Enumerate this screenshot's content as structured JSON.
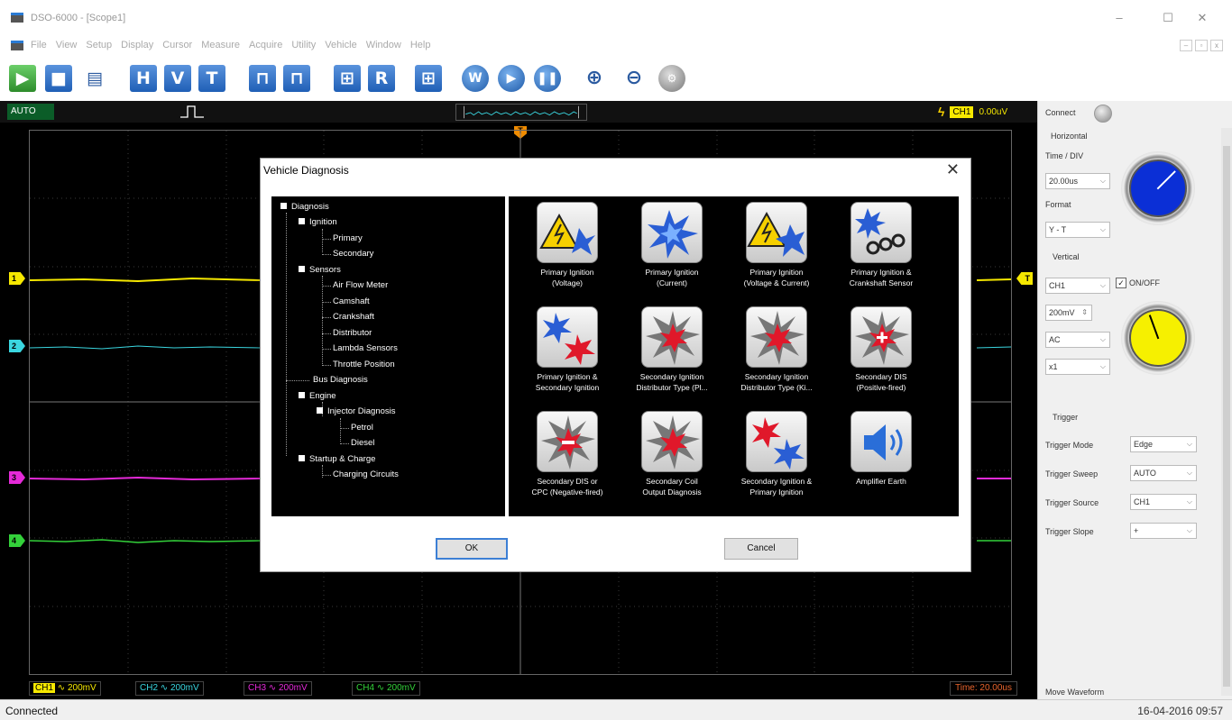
{
  "window": {
    "title": "DSO-6000 - [Scope1]",
    "controls": {
      "minimize": "–",
      "maximize": "☐",
      "close": "✕"
    }
  },
  "menu": {
    "items": [
      "File",
      "View",
      "Setup",
      "Display",
      "Cursor",
      "Measure",
      "Acquire",
      "Utility",
      "Vehicle",
      "Window",
      "Help"
    ],
    "mdi": {
      "min": "–",
      "restore": "▫",
      "close": "x"
    }
  },
  "toolbar": {
    "buttons": [
      {
        "name": "open",
        "glyph": "▶"
      },
      {
        "name": "save",
        "glyph": "■"
      },
      {
        "name": "print",
        "glyph": "▤"
      },
      {
        "name": "horizontal",
        "glyph": "H"
      },
      {
        "name": "vertical",
        "glyph": "V"
      },
      {
        "name": "trigger",
        "glyph": "T"
      },
      {
        "name": "measure-1",
        "glyph": "⊓"
      },
      {
        "name": "measure-2",
        "glyph": "⊓"
      },
      {
        "name": "ref-1",
        "glyph": "⊞"
      },
      {
        "name": "reference",
        "glyph": "R"
      },
      {
        "name": "ref-2",
        "glyph": "⊞"
      },
      {
        "name": "auto",
        "glyph": "W"
      },
      {
        "name": "run",
        "glyph": "▶"
      },
      {
        "name": "stop",
        "glyph": "❚❚"
      },
      {
        "name": "zoom-in",
        "glyph": "⊕"
      },
      {
        "name": "zoom-out",
        "glyph": "⊖"
      },
      {
        "name": "settings",
        "glyph": "⚙"
      }
    ]
  },
  "scope": {
    "mode": "AUTO",
    "trigger_channel": "CH1",
    "trigger_level": "0.00uV",
    "trigger_marker": "T",
    "channel_markers": [
      "1",
      "2",
      "3",
      "4"
    ],
    "footer": {
      "ch1": {
        "name": "CH1",
        "coupling": "∿",
        "scale": "200mV",
        "color": "#f6e800"
      },
      "ch2": {
        "name": "CH2",
        "coupling": "∿",
        "scale": "200mV",
        "color": "#3ad6e0"
      },
      "ch3": {
        "name": "CH3",
        "coupling": "∿",
        "scale": "200mV",
        "color": "#e52ad9"
      },
      "ch4": {
        "name": "CH4",
        "coupling": "∿",
        "scale": "200mV",
        "color": "#33d13a"
      },
      "time": "Time: 20.00us"
    }
  },
  "panel": {
    "connect": "Connect",
    "horizontal": {
      "title": "Horizontal",
      "time_div_label": "Time / DIV",
      "time_div": "20.00us",
      "format_label": "Format",
      "format": "Y - T"
    },
    "vertical": {
      "title": "Vertical",
      "channel": "CH1",
      "onoff_label": "ON/OFF",
      "onoff_checked": "✓",
      "volts": "200mV",
      "coupling": "AC",
      "probe": "x1"
    },
    "trigger": {
      "title": "Trigger",
      "mode_label": "Trigger Mode",
      "mode": "Edge",
      "sweep_label": "Trigger Sweep",
      "sweep": "AUTO",
      "source_label": "Trigger Source",
      "source": "CH1",
      "slope_label": "Trigger Slope",
      "slope": "+"
    },
    "move_waveform": "Move Waveform"
  },
  "statusbar": {
    "status": "Connected",
    "datetime": "16-04-2016  09:57"
  },
  "dialog": {
    "title": "Vehicle Diagnosis",
    "close": "✕",
    "tree": {
      "diagnosis": "Diagnosis",
      "ignition": "Ignition",
      "primary": "Primary",
      "secondary": "Secondary",
      "sensors": "Sensors",
      "air_flow": "Air Flow Meter",
      "camshaft": "Camshaft",
      "crankshaft": "Crankshaft",
      "distributor": "Distributor",
      "lambda": "Lambda Sensors",
      "throttle": "Throttle Position",
      "bus": "Bus Diagnosis",
      "engine": "Engine",
      "injector": "Injector Diagnosis",
      "petrol": "Petrol",
      "diesel": "Diesel",
      "startup": "Startup & Charge",
      "charging": "Charging Circuits"
    },
    "tiles": [
      {
        "line1": "Primary Ignition",
        "line2": "(Voltage)",
        "icon": "warning-spark-icon"
      },
      {
        "line1": "Primary Ignition",
        "line2": "(Current)",
        "icon": "blue-spark-icon"
      },
      {
        "line1": "Primary Ignition",
        "line2": "(Voltage & Current)",
        "icon": "warning-blue-spark-icon"
      },
      {
        "line1": "Primary Ignition &",
        "line2": "Crankshaft Sensor",
        "icon": "spark-gear-icon"
      },
      {
        "line1": "Primary Ignition &",
        "line2": "Secondary Ignition",
        "icon": "blue-red-spark-icon"
      },
      {
        "line1": "Secondary Ignition",
        "line2": "Distributor Type (Pl...",
        "icon": "red-spark-icon"
      },
      {
        "line1": "Secondary Ignition",
        "line2": "Distributor Type (Ki...",
        "icon": "red-spark-icon"
      },
      {
        "line1": "Secondary DIS",
        "line2": "(Positive-fired)",
        "icon": "positive-spark-icon"
      },
      {
        "line1": "Secondary DIS or",
        "line2": "CPC (Negative-fired)",
        "icon": "negative-spark-icon"
      },
      {
        "line1": "Secondary Coil",
        "line2": "Output Diagnosis",
        "icon": "red-spark-icon"
      },
      {
        "line1": "Secondary Ignition &",
        "line2": "Primary Ignition",
        "icon": "red-blue-spark-icon"
      },
      {
        "line1": "Amplifier Earth",
        "line2": "",
        "icon": "speaker-icon"
      }
    ],
    "ok": "OK",
    "cancel": "Cancel"
  }
}
